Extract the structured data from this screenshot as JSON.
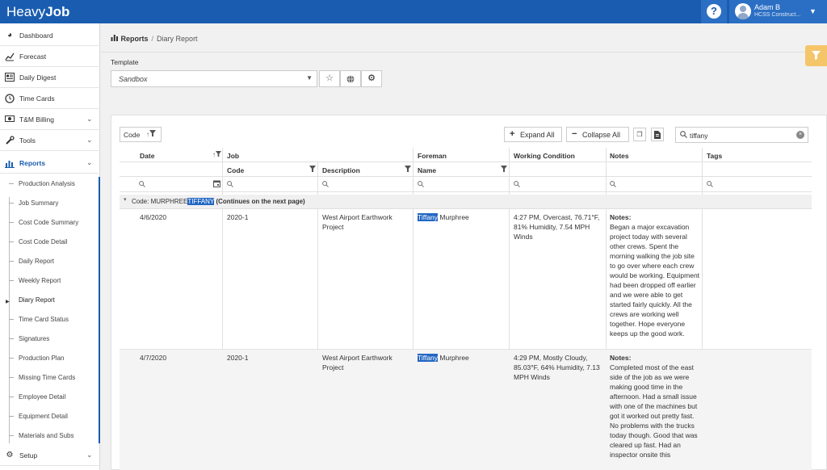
{
  "app": {
    "logo_light": "Heavy",
    "logo_bold": "Job"
  },
  "header": {
    "help_label": "?",
    "user_name": "Adam B",
    "user_company": "HCSS Construct..."
  },
  "sidebar": {
    "items": [
      {
        "label": "Dashboard",
        "icon": "speedometer-icon"
      },
      {
        "label": "Forecast",
        "icon": "line-chart-icon"
      },
      {
        "label": "Daily Digest",
        "icon": "newspaper-icon"
      },
      {
        "label": "Time Cards",
        "icon": "clock-icon"
      },
      {
        "label": "T&M Billing",
        "icon": "money-icon"
      },
      {
        "label": "Tools",
        "icon": "wrench-icon"
      },
      {
        "label": "Reports",
        "icon": "bar-chart-icon"
      },
      {
        "label": "Setup",
        "icon": "gear-icon"
      }
    ],
    "report_items": [
      "Production Analysis",
      "Job Summary",
      "Cost Code Summary",
      "Cost Code Detail",
      "Daily Report",
      "Weekly Report",
      "Diary Report",
      "Time Card Status",
      "Signatures",
      "Production Plan",
      "Missing Time Cards",
      "Employee Detail",
      "Equipment Detail",
      "Materials and Subs"
    ]
  },
  "breadcrumb": {
    "root": "Reports",
    "current": "Diary Report"
  },
  "template": {
    "label": "Template",
    "selected": "Sandbox"
  },
  "toolbar": {
    "group_by": "Code",
    "expand_all": "Expand All",
    "collapse_all": "Collapse All",
    "search_value": "tiffany"
  },
  "grid": {
    "headers": {
      "date": "Date",
      "job": "Job",
      "code": "Code",
      "description": "Description",
      "foreman": "Foreman",
      "name": "Name",
      "working_condition": "Working Condition",
      "notes": "Notes",
      "tags": "Tags"
    },
    "group": {
      "prefix": "Code: MURPHREE",
      "highlight": "TIFFANY",
      "suffix": " (Continues on the next page)"
    },
    "rows": [
      {
        "date": "4/6/2020",
        "code": "2020-1",
        "description": "West Airport Earthwork Project",
        "name_highlight": "Tiffany",
        "name_rest": " Murphree",
        "condition": "4:27 PM, Overcast, 76.71°F, 81% Humidity, 7.54 MPH Winds",
        "notes_title": "Notes:",
        "notes": "Began a major excavation project today with several other crews. Spent the morning walking the job site to go over where each crew would be working. Equipment had been dropped off earlier and we were able to get started fairly quickly. All the crews are working well together. Hope everyone keeps up the good work."
      },
      {
        "date": "4/7/2020",
        "code": "2020-1",
        "description": "West Airport Earthwork Project",
        "name_highlight": "Tiffany",
        "name_rest": " Murphree",
        "condition": "4:29 PM, Mostly Cloudy, 85.03°F, 64% Humidity, 7.13 MPH Winds",
        "notes_title": "Notes:",
        "notes": "Completed most of the east side of the job as we were making good time in the afternoon. Had a small issue with one of the machines but got it worked out pretty fast. No problems with the trucks today though. Good that was cleared up fast. Had an inspector onsite this"
      }
    ]
  }
}
